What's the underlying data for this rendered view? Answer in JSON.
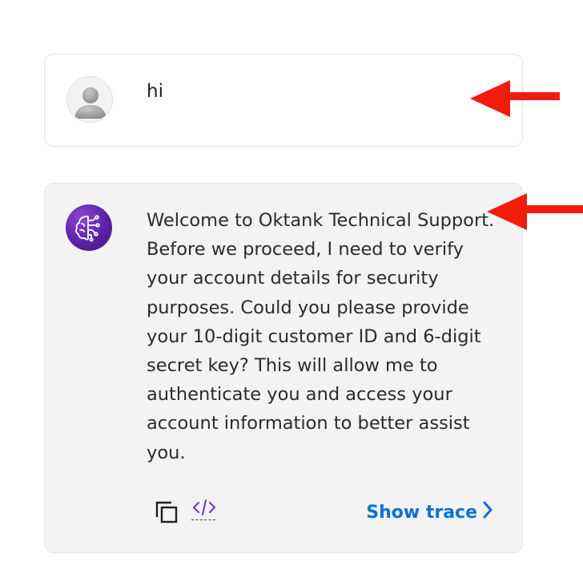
{
  "messages": [
    {
      "role": "user",
      "avatar": "user-avatar-icon",
      "text": "hi"
    },
    {
      "role": "assistant",
      "avatar": "ai-brain-icon",
      "text": "Welcome to Oktank Technical Support. Before we proceed, I need to verify your account details for security purposes. Could you please provide your 10-digit customer ID and 6-digit secret key? This will allow me to authenticate you and access your account information to better assist you.",
      "actions": {
        "copy_icon": "copy-icon",
        "code_icon": "code-icon",
        "show_trace_label": "Show trace"
      }
    }
  ],
  "colors": {
    "assistant_bg": "#f3f3f3",
    "link": "#0972d3",
    "annotation_arrow": "#f21c0d",
    "assistant_avatar": "#5b22a8"
  }
}
